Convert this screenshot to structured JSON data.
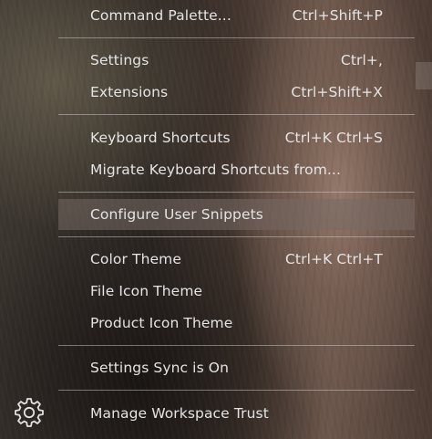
{
  "menu": {
    "items": [
      {
        "label": "Command Palette...",
        "shortcut": "Ctrl+Shift+P"
      },
      {
        "label": "Settings",
        "shortcut": "Ctrl+,"
      },
      {
        "label": "Extensions",
        "shortcut": "Ctrl+Shift+X"
      },
      {
        "label": "Keyboard Shortcuts",
        "shortcut": "Ctrl+K Ctrl+S"
      },
      {
        "label": "Migrate Keyboard Shortcuts from...",
        "shortcut": ""
      },
      {
        "label": "Configure User Snippets",
        "shortcut": ""
      },
      {
        "label": "Color Theme",
        "shortcut": "Ctrl+K Ctrl+T"
      },
      {
        "label": "File Icon Theme",
        "shortcut": ""
      },
      {
        "label": "Product Icon Theme",
        "shortcut": ""
      },
      {
        "label": "Settings Sync is On",
        "shortcut": ""
      },
      {
        "label": "Manage Workspace Trust",
        "shortcut": ""
      }
    ],
    "selected": "Configure User Snippets"
  },
  "icons": {
    "manage": "gear-icon"
  },
  "colors": {
    "text": "#e4e4e4",
    "separator": "#cdcdcd",
    "selection": "#766a64"
  }
}
